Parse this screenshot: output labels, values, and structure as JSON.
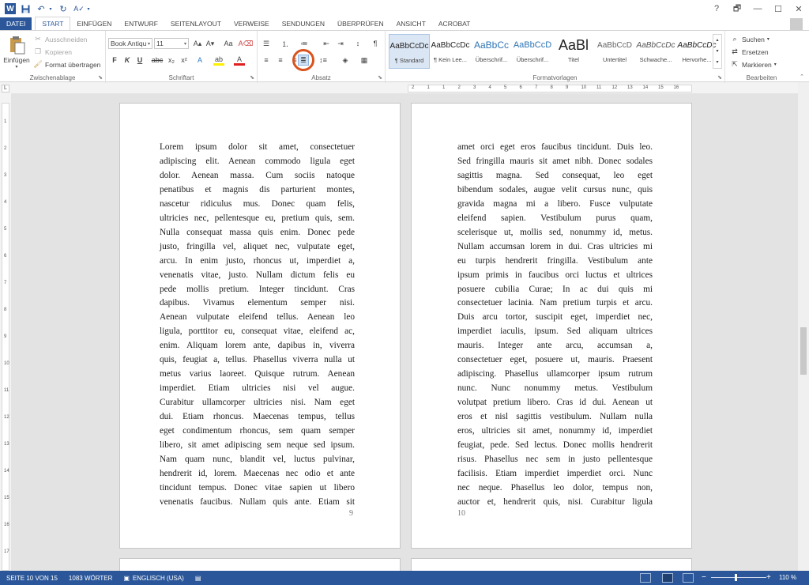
{
  "app": {
    "title_buttons": [
      "?",
      "🗗",
      "—",
      "☐",
      "✕"
    ]
  },
  "tabs": [
    "DATEI",
    "START",
    "EINFÜGEN",
    "ENTWURF",
    "SEITENLAYOUT",
    "VERWEISE",
    "SENDUNGEN",
    "ÜBERPRÜFEN",
    "ANSICHT",
    "ACROBAT"
  ],
  "ribbon": {
    "clipboard": {
      "paste_label": "Einfügen",
      "cut_label": "Ausschneiden",
      "copy_label": "Kopieren",
      "format_painter_label": "Format übertragen",
      "group_label": "Zwischenablage"
    },
    "font": {
      "font_name": "Book Antiqu",
      "font_size": "11",
      "group_label": "Schriftart"
    },
    "paragraph": {
      "group_label": "Absatz"
    },
    "styles": {
      "group_label": "Formatvorlagen",
      "items": [
        {
          "preview": "AaBbCcDc",
          "name": "¶ Standard"
        },
        {
          "preview": "AaBbCcDc",
          "name": "¶ Kein Lee..."
        },
        {
          "preview": "AaBbCc",
          "name": "Überschrif..."
        },
        {
          "preview": "AaBbCcD",
          "name": "Überschrif..."
        },
        {
          "preview": "AaBl",
          "name": "Titel"
        },
        {
          "preview": "AaBbCcD",
          "name": "Untertitel"
        },
        {
          "preview": "AaBbCcDc",
          "name": "Schwache..."
        },
        {
          "preview": "AaBbCcDc",
          "name": "Hervorhe..."
        }
      ]
    },
    "editing": {
      "find_label": "Suchen",
      "replace_label": "Ersetzen",
      "select_label": "Markieren",
      "group_label": "Bearbeiten"
    }
  },
  "ruler": {
    "h_numbers": [
      "2",
      "1",
      "1",
      "2",
      "3",
      "4",
      "5",
      "6",
      "7",
      "8",
      "9",
      "10",
      "11",
      "12",
      "13",
      "14",
      "15",
      "16"
    ],
    "v_numbers": [
      "1",
      "2",
      "3",
      "4",
      "5",
      "6",
      "7",
      "8",
      "9",
      "10",
      "11",
      "12",
      "13",
      "14",
      "15",
      "16",
      "17"
    ]
  },
  "document": {
    "left_page_lines": [
      "Lorem ipsum dolor sit amet, consectetuer",
      "adipiscing elit. Aenean commodo ligula eget",
      "dolor. Aenean massa. Cum sociis natoque",
      "penatibus et magnis dis parturient montes,",
      "nascetur ridiculus mus. Donec quam felis,",
      "ultricies nec, pellentesque eu, pretium quis, sem.",
      "Nulla consequat massa quis enim. Donec pede",
      "justo, fringilla vel, aliquet nec, vulputate eget,",
      "arcu. In enim justo, rhoncus ut, imperdiet a,",
      "venenatis vitae, justo. Nullam dictum felis eu",
      "pede mollis pretium. Integer tincidunt. Cras",
      "dapibus. Vivamus elementum semper nisi.",
      "Aenean vulputate eleifend tellus. Aenean leo",
      "ligula, porttitor eu, consequat vitae, eleifend ac,",
      "enim. Aliquam lorem ante, dapibus in, viverra",
      "quis, feugiat a, tellus. Phasellus viverra nulla ut",
      "metus varius laoreet. Quisque rutrum. Aenean",
      "imperdiet. Etiam ultricies nisi vel augue.",
      "Curabitur ullamcorper ultricies nisi. Nam eget",
      "dui. Etiam rhoncus. Maecenas tempus, tellus",
      "eget condimentum rhoncus, sem quam semper",
      "libero, sit amet adipiscing sem neque sed ipsum.",
      "Nam quam nunc, blandit vel, luctus pulvinar,",
      "hendrerit id, lorem. Maecenas nec odio et ante",
      "tincidunt tempus. Donec vitae sapien ut libero",
      "venenatis faucibus. Nullam quis ante. Etiam sit"
    ],
    "left_page_number": "9",
    "right_page_lines": [
      "amet orci eget eros faucibus tincidunt. Duis leo.",
      "Sed fringilla mauris sit amet nibh. Donec sodales",
      "sagittis magna. Sed consequat, leo eget",
      "bibendum sodales, augue velit cursus nunc, quis",
      "gravida magna mi a libero. Fusce vulputate",
      "eleifend sapien. Vestibulum purus quam,",
      "scelerisque ut, mollis sed, nonummy id, metus.",
      "Nullam accumsan lorem in dui. Cras ultricies mi",
      "eu turpis hendrerit fringilla. Vestibulum ante",
      "ipsum primis in faucibus orci luctus et ultrices",
      "posuere cubilia Curae; In ac dui quis mi",
      "consectetuer lacinia. Nam pretium turpis et arcu.",
      "Duis arcu tortor, suscipit eget, imperdiet nec,",
      "imperdiet iaculis, ipsum. Sed aliquam ultrices",
      "mauris. Integer ante arcu, accumsan a,",
      "consectetuer eget, posuere ut, mauris. Praesent",
      "adipiscing. Phasellus ullamcorper ipsum rutrum",
      "nunc. Nunc nonummy metus. Vestibulum",
      "volutpat pretium libero. Cras id dui. Aenean ut",
      "eros et nisl sagittis vestibulum. Nullam nulla",
      "eros, ultricies sit amet, nonummy id, imperdiet",
      "feugiat, pede. Sed lectus. Donec mollis hendrerit",
      "risus. Phasellus nec sem in justo pellentesque",
      "facilisis. Etiam imperdiet imperdiet orci. Nunc",
      "nec neque. Phasellus leo dolor, tempus non,",
      "auctor et, hendrerit quis, nisi. Curabitur ligula"
    ],
    "right_page_number": "10"
  },
  "status": {
    "page": "SEITE 10 VON 15",
    "words": "1083 WÖRTER",
    "language": "ENGLISCH (USA)",
    "zoom_minus": "−",
    "zoom_plus": "+",
    "zoom": "110 %"
  },
  "colors": {
    "accent": "#2b579a",
    "highlight": "#d9531e"
  }
}
